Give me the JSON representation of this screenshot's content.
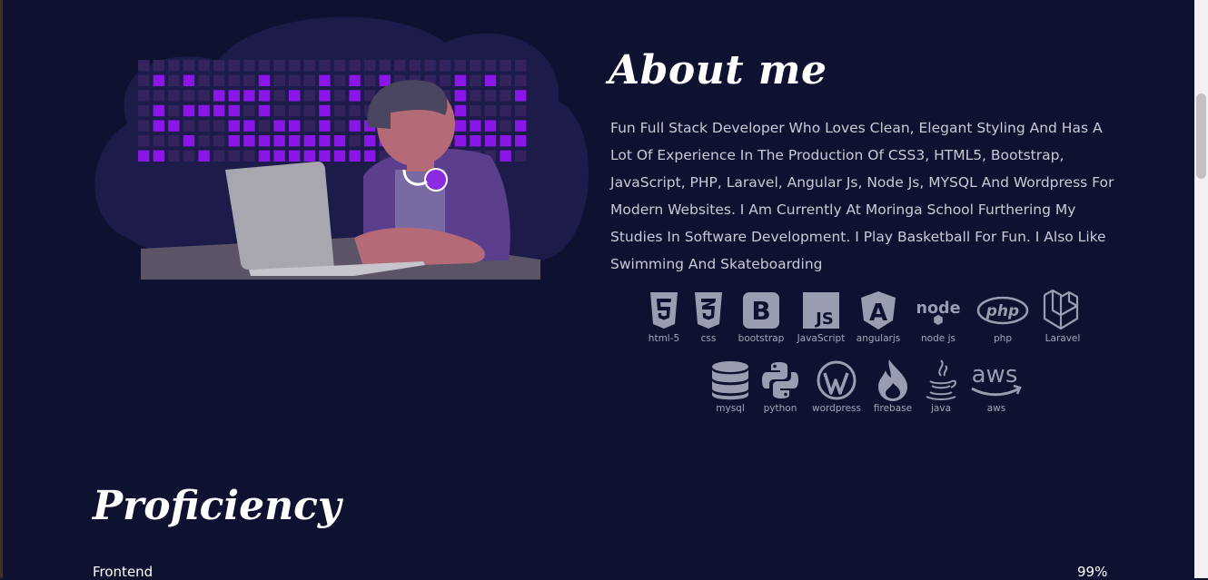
{
  "about": {
    "title": "About me",
    "text": "Fun Full Stack Developer Who Loves Clean, Elegant Styling And Has A Lot Of Experience In The Production Of CSS3, HTML5, Bootstrap, JavaScript, PHP, Laravel, Angular Js, Node Js, MYSQL And Wordpress For Modern Websites. I Am Currently At Moringa School Furthering My Studies In Software Development. I Play Basketball For Fun. I Also Like Swimming And Skateboarding"
  },
  "skills_row1": [
    {
      "label": "html-5",
      "icon": "html5-icon"
    },
    {
      "label": "css",
      "icon": "css3-icon"
    },
    {
      "label": "bootstrap",
      "icon": "bootstrap-icon"
    },
    {
      "label": "JavaScript",
      "icon": "javascript-icon"
    },
    {
      "label": "angularjs",
      "icon": "angular-icon"
    },
    {
      "label": "node js",
      "icon": "nodejs-icon"
    },
    {
      "label": "php",
      "icon": "php-icon"
    },
    {
      "label": "Laravel",
      "icon": "laravel-icon"
    }
  ],
  "skills_row2": [
    {
      "label": "mysql",
      "icon": "database-icon"
    },
    {
      "label": "python",
      "icon": "python-icon"
    },
    {
      "label": "wordpress",
      "icon": "wordpress-icon"
    },
    {
      "label": "firebase",
      "icon": "firebase-icon"
    },
    {
      "label": "java",
      "icon": "java-icon"
    },
    {
      "label": "aws",
      "icon": "aws-icon"
    }
  ],
  "icon_text": {
    "bootstrap": "B",
    "javascript": "JS",
    "angular": "A",
    "node": "node",
    "php": "php",
    "aws": "aws"
  },
  "proficiency": {
    "title": "Proficiency",
    "items": [
      {
        "label": "Frontend",
        "value": "99%"
      }
    ]
  },
  "colors": {
    "background": "#0f1130",
    "accent_purple": "#8a2be2",
    "icon_gray": "#9a9cb1"
  }
}
